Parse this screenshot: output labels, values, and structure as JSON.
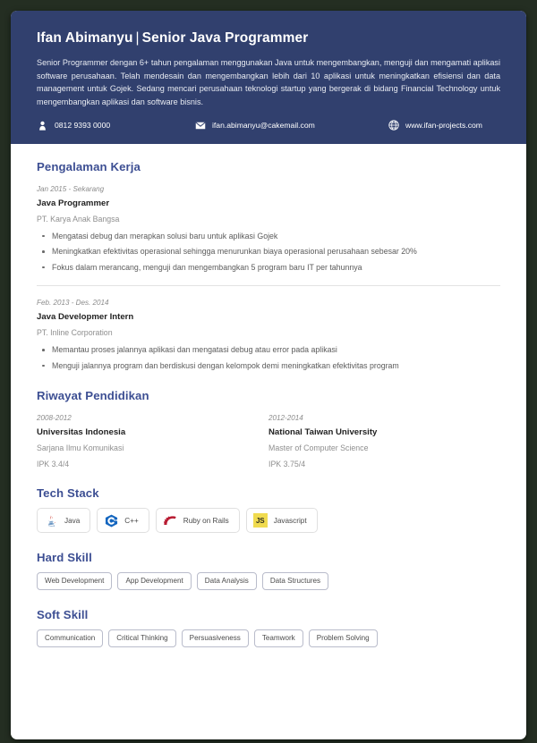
{
  "header": {
    "name": "Ifan Abimanyu",
    "separator": "|",
    "job_title": "Senior Java Programmer",
    "summary": "Senior Programmer dengan 6+ tahun pengalaman menggunakan Java untuk mengembangkan, menguji dan mengamati aplikasi software perusahaan. Telah mendesain dan mengembangkan lebih dari 10 aplikasi untuk meningkatkan efisiensi dan data management untuk Gojek. Sedang mencari perusahaan teknologi startup yang bergerak di bidang Financial Technology untuk mengembangkan aplikasi dan software bisnis.",
    "background_color": "#31406e",
    "contacts": [
      {
        "icon": "person-icon",
        "value": "0812 9393 0000"
      },
      {
        "icon": "envelope-icon",
        "value": "ifan.abimanyu@cakemail.com"
      },
      {
        "icon": "globe-icon",
        "value": "www.ifan-projects.com"
      }
    ]
  },
  "experience": {
    "title": "Pengalaman Kerja",
    "entries": [
      {
        "date": "Jan 2015 - Sekarang",
        "role": "Java Programmer",
        "company": "PT. Karya Anak Bangsa",
        "bullets": [
          "Mengatasi debug dan merapkan solusi baru untuk aplikasi Gojek",
          "Meningkatkan efektivitas operasional sehingga menurunkan biaya operasional perusahaan sebesar 20%",
          "Fokus dalam merancang, menguji dan mengembangkan 5 program baru IT per tahunnya"
        ]
      },
      {
        "date": "Feb. 2013 - Des. 2014",
        "role": "Java Developmer Intern",
        "company": "PT. Inline Corporation",
        "bullets": [
          "Memantau proses jalannya aplikasi dan mengatasi debug atau error pada aplikasi",
          "Menguji jalannya program dan berdiskusi dengan kelompok demi meningkatkan efektivitas program"
        ]
      }
    ]
  },
  "education": {
    "title": "Riwayat Pendidikan",
    "entries": [
      {
        "date": "2008-2012",
        "school": "Universitas Indonesia",
        "degree": "Sarjana Ilmu Komunikasi",
        "gpa": "IPK 3.4/4"
      },
      {
        "date": "2012-2014",
        "school": "National Taiwan University",
        "degree": "Master of Computer Science",
        "gpa": "IPK 3.75/4"
      }
    ]
  },
  "tech_stack": {
    "title": "Tech Stack",
    "items": [
      {
        "label": "Java",
        "icon": "java-icon"
      },
      {
        "label": "C++",
        "icon": "cplusplus-icon"
      },
      {
        "label": "Ruby on Rails",
        "icon": "rails-icon"
      },
      {
        "label": "Javascript",
        "icon": "javascript-icon",
        "badge_text": "JS"
      }
    ]
  },
  "hard_skill": {
    "title": "Hard Skill",
    "items": [
      "Web Development",
      "App Development",
      "Data Analysis",
      "Data Structures"
    ]
  },
  "soft_skill": {
    "title": "Soft Skill",
    "items": [
      "Communication",
      "Critical Thinking",
      "Persuasiveness",
      "Teamwork",
      "Problem Solving"
    ]
  },
  "theme": {
    "heading_color": "#3d4f93",
    "header_bg": "#31406e",
    "page_bg": "#242e22",
    "js_yellow": "#f0db4f",
    "rails_red": "#b81b32",
    "cpp_blue": "#1466bf"
  }
}
